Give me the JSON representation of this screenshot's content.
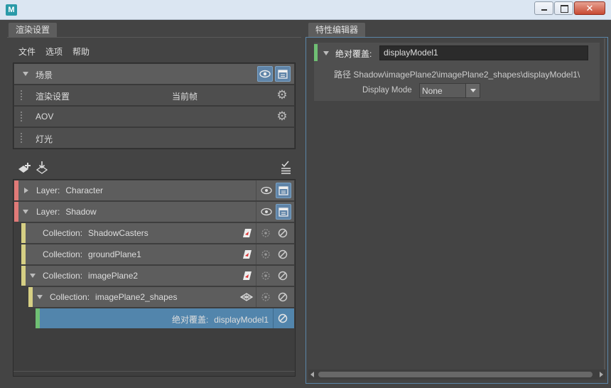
{
  "window": {
    "logo": "M"
  },
  "left_panel": {
    "tab": "渲染设置",
    "menu": [
      "文件",
      "选项",
      "帮助"
    ],
    "settings": [
      {
        "label": "场景"
      },
      {
        "label": "渲染设置",
        "extra": "当前帧"
      },
      {
        "label": "AOV"
      },
      {
        "label": "灯光"
      }
    ],
    "tree": [
      {
        "type": "Layer:",
        "name": "Character"
      },
      {
        "type": "Layer:",
        "name": "Shadow"
      },
      {
        "type": "Collection:",
        "name": "ShadowCasters"
      },
      {
        "type": "Collection:",
        "name": "groundPlane1"
      },
      {
        "type": "Collection:",
        "name": "imagePlane2"
      },
      {
        "type": "Collection:",
        "name": "imagePlane2_shapes"
      },
      {
        "type": "绝对覆盖:",
        "name": "displayModel1"
      }
    ],
    "colors": {
      "layer": "#e07a78",
      "collection": "#d6cf84",
      "override": "#6fbf74",
      "selected": "#5285ac"
    }
  },
  "right_panel": {
    "tab": "特性编辑器",
    "attr_label": "绝对覆盖:",
    "attr_value": "displayModel1",
    "path_label": "路径",
    "path_value": "Shadow\\imagePlane2\\imagePlane2_shapes\\displayModel1\\",
    "display_mode_label": "Display Mode",
    "display_mode_value": "None"
  }
}
